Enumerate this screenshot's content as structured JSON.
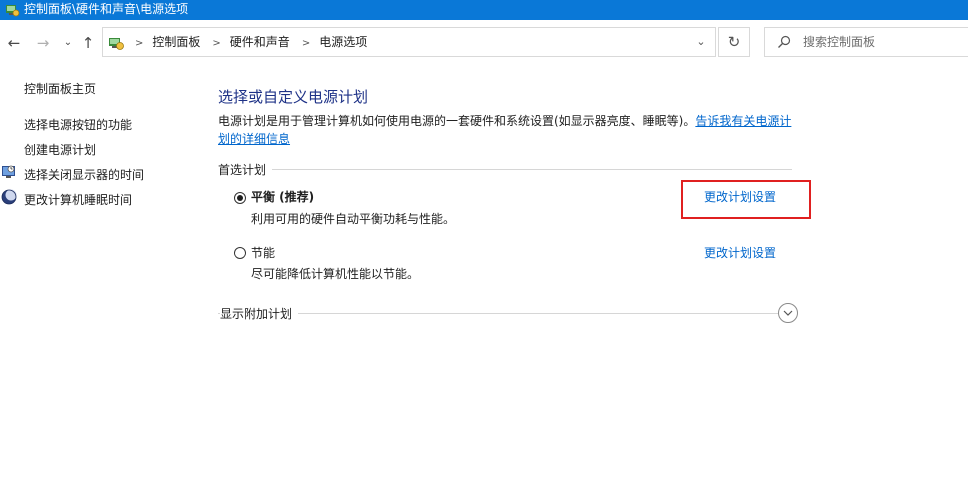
{
  "window": {
    "title": "控制面板\\硬件和声音\\电源选项"
  },
  "nav": {
    "back_icon": "arrow-left-icon",
    "forward_icon": "arrow-right-icon",
    "recent_icon": "chevron-down-icon",
    "up_icon": "arrow-up-icon",
    "breadcrumbs": [
      "控制面板",
      "硬件和声音",
      "电源选项"
    ],
    "refresh_icon": "refresh-icon",
    "search_placeholder": "搜索控制面板"
  },
  "sidebar": {
    "home": "控制面板主页",
    "links": [
      {
        "label": "选择电源按钮的功能",
        "icon": null
      },
      {
        "label": "创建电源计划",
        "icon": null
      },
      {
        "label": "选择关闭显示器的时间",
        "icon": "monitor-icon"
      },
      {
        "label": "更改计算机睡眠时间",
        "icon": "moon-icon"
      }
    ]
  },
  "main": {
    "title": "选择或自定义电源计划",
    "description": "电源计划是用于管理计算机如何使用电源的一套硬件和系统设置(如显示器亮度、睡眠等)。",
    "description_link": "告诉我有关电源计划的详细信息",
    "preferred_label": "首选计划",
    "plans": [
      {
        "name": "平衡 (推荐)",
        "description": "利用可用的硬件自动平衡功耗与性能。",
        "link": "更改计划设置",
        "selected": true
      },
      {
        "name": "节能",
        "description": "尽可能降低计算机性能以节能。",
        "link": "更改计划设置",
        "selected": false
      }
    ],
    "additional_label": "显示附加计划"
  },
  "colors": {
    "titlebar": "#0a78d7",
    "title_text": "#1e3287",
    "link": "#0066cc",
    "highlight": "#e02020"
  }
}
